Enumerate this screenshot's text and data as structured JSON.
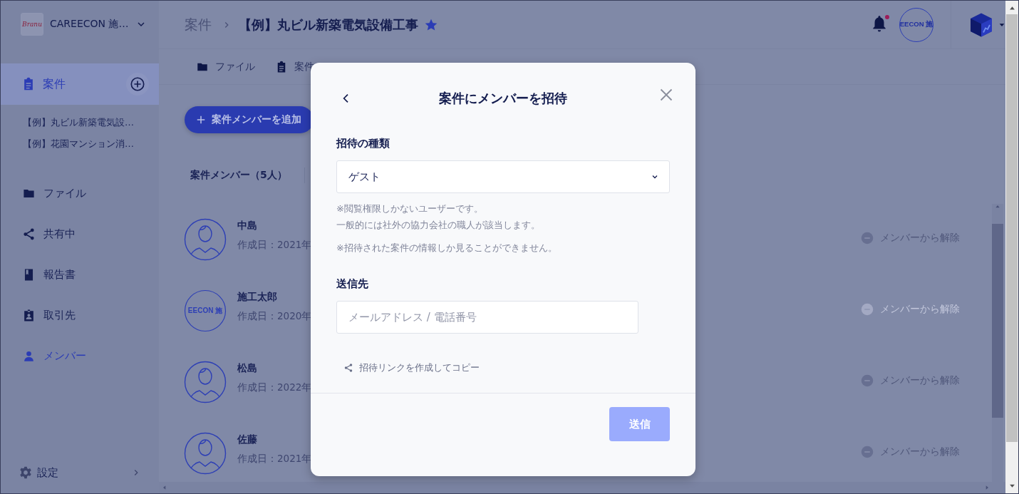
{
  "sidebar": {
    "org": {
      "logo_text": "Branu",
      "name": "CAREECON 施…"
    },
    "section": {
      "label": "案件",
      "selected": true
    },
    "projects": [
      "【例】丸ビル新築電気設…",
      "【例】花園マンション消…"
    ],
    "items": [
      {
        "label": "ファイル",
        "kind": "folder",
        "selected": false
      },
      {
        "label": "共有中",
        "kind": "share",
        "selected": false
      },
      {
        "label": "報告書",
        "kind": "book",
        "selected": false
      },
      {
        "label": "取引先",
        "kind": "badge",
        "selected": false
      },
      {
        "label": "メンバー",
        "kind": "person",
        "selected": true
      }
    ],
    "settings": "設定"
  },
  "header": {
    "breadcrumb": "案件",
    "title": "【例】丸ビル新築電気設備工事",
    "starred": true,
    "unread": true,
    "avatar_text": "EECON 施"
  },
  "tabs": [
    {
      "label": "ファイル",
      "kind": "folder"
    },
    {
      "label": "案件",
      "kind": "clipboard"
    }
  ],
  "add_member_button": "案件メンバーを追加",
  "members_heading": "案件メンバー（5人）",
  "members": [
    {
      "name": "中島",
      "created": "作成日：2021年",
      "kind": "person",
      "remove": "メンバーから解除",
      "disabled": false
    },
    {
      "name": "施工太郎",
      "created": "作成日：2020年",
      "kind": "logo",
      "logo_text": "EECON 施",
      "remove": "メンバーから解除",
      "disabled": true
    },
    {
      "name": "松島",
      "created": "作成日：2022年",
      "kind": "person",
      "remove": "メンバーから解除",
      "disabled": false
    },
    {
      "name": "佐藤",
      "created": "作成日：2021年",
      "kind": "person",
      "remove": "メンバーから解除",
      "disabled": false
    }
  ],
  "dialog": {
    "title": "案件にメンバーを招待",
    "type_label": "招待の種類",
    "type_value": "ゲスト",
    "notes": [
      [
        "※閲覧権限しかないユーザーです。",
        "一般的には社外の協力会社の職人が該当します。"
      ],
      [
        "※招待された案件の情報しか見ることができません。"
      ]
    ],
    "recipient_label": "送信先",
    "recipient_placeholder": "メールアドレス / 電話番号",
    "link_label": "招待リンクを作成してコピー",
    "send_button": {
      "label": "送信",
      "disabled": true
    }
  }
}
